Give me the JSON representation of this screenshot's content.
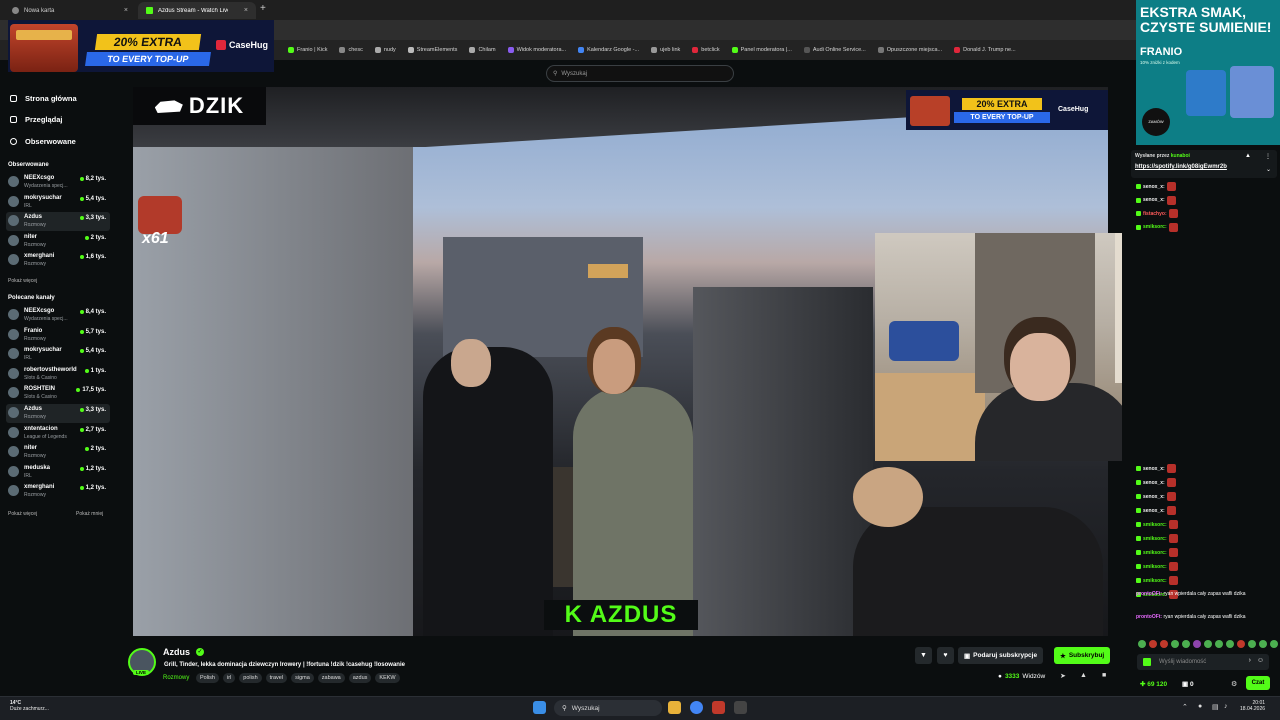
{
  "browser": {
    "tabs": [
      {
        "label": "Nowa karta",
        "active": false
      },
      {
        "label": "Azdus Stream - Watch Live",
        "active": true
      }
    ],
    "new_tab": "+",
    "close": "×",
    "bookmarks": [
      "Franio | Kick",
      "chesc",
      "nudy",
      "StreamElements",
      "Chilam",
      "Widok moderatora...",
      "Kalendarz Google -...",
      "ujeb link",
      "betclick",
      "Panel moderatora |...",
      "Audi Online Service...",
      "Opuszczone miejsca...",
      "Donald J. Trump ne..."
    ]
  },
  "header": {
    "search_placeholder": "Wyszukaj"
  },
  "ads": {
    "top_left": {
      "line1": "20% EXTRA",
      "line2": "TO EVERY TOP-UP",
      "brand": "CaseHug"
    },
    "video": {
      "line1": "20% EXTRA",
      "line2": "TO EVERY TOP-UP",
      "brand": "CaseHug"
    },
    "right": {
      "line1": "EKSTRA SMAK,",
      "line2": "CZYSTE SUMIENIE!",
      "brand": "FRANIO",
      "fine": "10% zniżki z kodem",
      "badge": "ZAMÓW WYSYŁKĘ"
    }
  },
  "sidebar": {
    "nav": [
      {
        "label": "Strona główna",
        "icon": "home-icon"
      },
      {
        "label": "Przeglądaj",
        "icon": "browse-icon"
      },
      {
        "label": "Obserwowane",
        "icon": "heart-icon"
      }
    ],
    "followed_title": "Obserwowane",
    "followed": [
      {
        "name": "NEEXcsgo",
        "category": "Wydarzenia specj...",
        "viewers": "8,2 tys."
      },
      {
        "name": "mokrysuchar",
        "category": "IRL",
        "viewers": "5,4 tys."
      },
      {
        "name": "Azdus",
        "category": "Rozmowy",
        "viewers": "3,3 tys."
      },
      {
        "name": "niter",
        "category": "Rozmowy",
        "viewers": "2 tys."
      },
      {
        "name": "xmerghani",
        "category": "Rozmowy",
        "viewers": "1,6 tys."
      }
    ],
    "followed_more": "Pokaż więcej",
    "recommended_title": "Polecane kanały",
    "recommended": [
      {
        "name": "NEEXcsgo",
        "category": "Wydarzenia specj...",
        "viewers": "8,4 tys."
      },
      {
        "name": "Franio",
        "category": "Rozmowy",
        "viewers": "5,7 tys."
      },
      {
        "name": "mokrysuchar",
        "category": "IRL",
        "viewers": "5,4 tys."
      },
      {
        "name": "robertovstheworld",
        "category": "Slots & Casino",
        "viewers": "1 tys."
      },
      {
        "name": "ROSHTEIN",
        "category": "Slots & Casino",
        "viewers": "17,5 tys."
      },
      {
        "name": "Azdus",
        "category": "Rozmowy",
        "viewers": "3,3 tys."
      },
      {
        "name": "xntentacion",
        "category": "League of Legends",
        "viewers": "2,7 tys."
      },
      {
        "name": "niter",
        "category": "Rozmowy",
        "viewers": "2 tys."
      },
      {
        "name": "meduska",
        "category": "IRL",
        "viewers": "1,2 tys."
      },
      {
        "name": "xmerghani",
        "category": "Rozmowy",
        "viewers": "1,2 tys."
      }
    ],
    "rec_more": "Pokaż więcej",
    "rec_less": "Pokaż mniej"
  },
  "video": {
    "logo": "DZIK",
    "emote_count": "x61",
    "tag": "K AZDUS"
  },
  "stream": {
    "name": "Azdus",
    "live": "LIVE",
    "title": "Grill, Tinder, lekka dominacja dziewczyn Irowery | !fortuna !dzik !casehug !losowanie",
    "category": "Rozmowy",
    "tags": [
      "Polish",
      "irl",
      "polish",
      "travel",
      "sigma",
      "zabawa",
      "azdus",
      "KEKW"
    ],
    "gift_label": "Podaruj subskrypcje",
    "sub_label": "Subskrybuj",
    "viewers": "3333",
    "viewers_label": "Widzów"
  },
  "chat": {
    "pinned_by": "Wysłane przez",
    "pinned_user": "kunaboi",
    "pinned_link": "https://spotify.link/g08igEwmr2b",
    "messages_top": [
      {
        "user": "senox_x:",
        "color": "#f2f2f2"
      },
      {
        "user": "senox_x:",
        "color": "#f2f2f2"
      },
      {
        "user": "fistachyo:",
        "color": "#ff5b5b"
      },
      {
        "user": "smiksorc:",
        "color": "#53fc18"
      }
    ],
    "messages_bottom": [
      {
        "user": "senox_x:",
        "color": "#f2f2f2"
      },
      {
        "user": "senox_x:",
        "color": "#f2f2f2"
      },
      {
        "user": "senox_x:",
        "color": "#f2f2f2"
      },
      {
        "user": "senox_x:",
        "color": "#f2f2f2"
      },
      {
        "user": "smiksorc:",
        "color": "#53fc18"
      },
      {
        "user": "smiksorc:",
        "color": "#53fc18"
      },
      {
        "user": "smiksorc:",
        "color": "#53fc18"
      },
      {
        "user": "smiksorc:",
        "color": "#53fc18"
      },
      {
        "user": "smiksorc:",
        "color": "#53fc18"
      },
      {
        "user": "smiksorc:",
        "color": "#53fc18"
      }
    ],
    "text_messages": [
      {
        "user": "prontoOFt:",
        "text": "ryan wpierdala cały zapas wafli dzika"
      },
      {
        "user": "prontoOFt:",
        "text": "ryan wpierdala cały zapas wafli dzika"
      }
    ],
    "input_placeholder": "Wyślij wiadomość",
    "points": "69 120",
    "points2": "0",
    "send_label": "Czat"
  },
  "taskbar": {
    "temp": "14°C",
    "weather": "Duże zachmurz...",
    "search": "Wyszukaj",
    "time": "20:01",
    "date": "18.04.2026"
  },
  "colors": {
    "accent": "#53fc18",
    "bg": "#0b0e0f"
  }
}
